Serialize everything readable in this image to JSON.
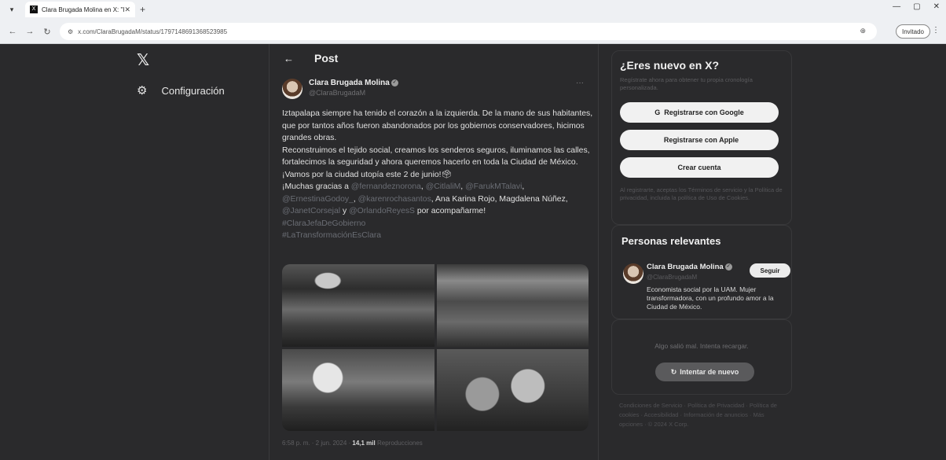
{
  "browser": {
    "menu_icon": "▾",
    "tab_favicon": "X",
    "tab_title": "Clara Brugada Molina en X: \"Izt",
    "tab_close": "✕",
    "new_tab": "+",
    "controls": [
      "—",
      "▢",
      "✕"
    ],
    "back": "←",
    "forward": "→",
    "reload": "↻",
    "site_info_icon": "⚙",
    "url": "x.com/ClaraBrugadaM/status/1797148691368523985",
    "zoom_icon": "⊕",
    "incognito_label": "Invitado",
    "more_menu": "⋮"
  },
  "sidebar": {
    "logo": "𝕏",
    "settings_icon": "⚙",
    "settings_label": "Configuración"
  },
  "post": {
    "back_icon": "←",
    "header_title": "Post",
    "author_name": "Clara Brugada Molina",
    "verified_icon": "✓",
    "author_handle": "@ClaraBrugadaM",
    "more_icon": "···",
    "text_1": "Iztapalapa siempre ha tenido el corazón a la izquierda. De la mano de sus habitantes, que por tantos años fueron abandonados por los gobiernos conservadores, hicimos grandes obras.",
    "text_2": "Reconstruimos el tejido social, creamos los senderos seguros, iluminamos las calles, fortalecimos la seguridad y ahora queremos hacerlo en toda la Ciudad de México. ¡Vamos por la ciudad utopía este 2 de junio!🗳",
    "thanks_prefix": "¡Muchas gracias a ",
    "mention_1": "@fernandeznorona",
    "mention_2": "@CitlaliM",
    "mention_3": "@FarukMTalavi",
    "mention_4": "@ErnestinaGodoy_",
    "mention_5": "@karenrochasantos",
    "thanks_names": "Ana Karina Rojo, Magdalena Núñez",
    "mention_6": "@JanetCorsejal",
    "and_word": "y",
    "mention_7": "@OrlandoReyesS",
    "thanks_suffix": "por acompañarme!",
    "hashtag_1": "#ClaraJefaDeGobierno",
    "hashtag_2": "#LaTransformaciónEsClara",
    "time": "6:58 p. m. · 2 jun. 2024",
    "views_count": "14,1 mil",
    "views_label": "Reproducciones"
  },
  "signup": {
    "heading": "¿Eres nuevo en X?",
    "sub": "Regístrate ahora para obtener tu propia cronología personalizada.",
    "google_icon": "G",
    "google_label": "Registrarse con Google",
    "apple_icon": "",
    "apple_label": "Registrarse con Apple",
    "create_label": "Crear cuenta",
    "legal": "Al registrarte, aceptas los Términos de servicio y la Política de privacidad, incluida la política de Uso de Cookies."
  },
  "relevant": {
    "heading": "Personas relevantes",
    "name": "Clara Brugada Molina",
    "verified_icon": "✓",
    "handle": "@ClaraBrugadaM",
    "follow_label": "Seguir",
    "bio": "Economista social por la UAM. Mujer transformadora, con un profundo amor a la Ciudad de México."
  },
  "error": {
    "message": "Algo salió mal. Intenta recargar.",
    "retry_icon": "↻",
    "retry_label": "Intentar de nuevo"
  },
  "footer": {
    "text": "Condiciones de Servicio · Política de Privacidad · Política de cookies · Accesibilidad · Información de anuncios · Más opciones · © 2024 X Corp."
  }
}
